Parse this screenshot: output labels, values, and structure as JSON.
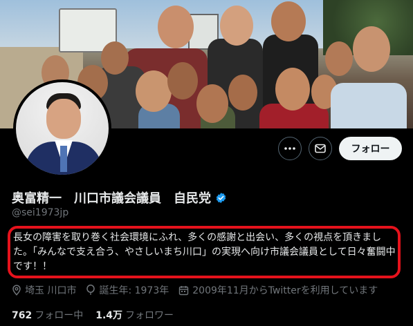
{
  "profile": {
    "display_name": "奥富精一　川口市議会議員　自民党",
    "handle": "@sei1973jp",
    "verified_icon": "verified-badge-icon",
    "bio": "長女の障害を取り巻く社会環境にふれ、多くの感謝と出会い、多くの視点を頂きました。「みんなで支え合う、やさしいまち川口」の実現へ向け市議会議員として日々奮闘中です！！"
  },
  "actions": {
    "more_icon": "more-icon",
    "message_icon": "message-icon",
    "follow_label": "フォロー"
  },
  "meta": {
    "location": "埼玉 川口市",
    "birthday": "誕生年: 1973年",
    "joined": "2009年11月からTwitterを利用しています"
  },
  "stats": {
    "following_count": "762",
    "following_label": "フォロー中",
    "followers_count": "1.4万",
    "followers_label": "フォロワー"
  },
  "colors": {
    "background": "#000000",
    "verified_blue": "#1d9bf0",
    "highlight_red": "#e5121c",
    "muted_text": "#71767b"
  }
}
